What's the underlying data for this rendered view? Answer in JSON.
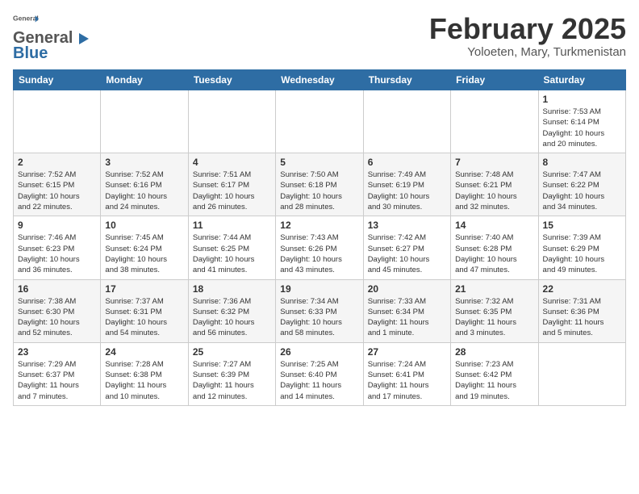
{
  "header": {
    "logo_line1": "General",
    "logo_line2": "Blue",
    "month": "February 2025",
    "location": "Yoloeten, Mary, Turkmenistan"
  },
  "weekdays": [
    "Sunday",
    "Monday",
    "Tuesday",
    "Wednesday",
    "Thursday",
    "Friday",
    "Saturday"
  ],
  "weeks": [
    [
      {
        "day": "",
        "info": ""
      },
      {
        "day": "",
        "info": ""
      },
      {
        "day": "",
        "info": ""
      },
      {
        "day": "",
        "info": ""
      },
      {
        "day": "",
        "info": ""
      },
      {
        "day": "",
        "info": ""
      },
      {
        "day": "1",
        "info": "Sunrise: 7:53 AM\nSunset: 6:14 PM\nDaylight: 10 hours\nand 20 minutes."
      }
    ],
    [
      {
        "day": "2",
        "info": "Sunrise: 7:52 AM\nSunset: 6:15 PM\nDaylight: 10 hours\nand 22 minutes."
      },
      {
        "day": "3",
        "info": "Sunrise: 7:52 AM\nSunset: 6:16 PM\nDaylight: 10 hours\nand 24 minutes."
      },
      {
        "day": "4",
        "info": "Sunrise: 7:51 AM\nSunset: 6:17 PM\nDaylight: 10 hours\nand 26 minutes."
      },
      {
        "day": "5",
        "info": "Sunrise: 7:50 AM\nSunset: 6:18 PM\nDaylight: 10 hours\nand 28 minutes."
      },
      {
        "day": "6",
        "info": "Sunrise: 7:49 AM\nSunset: 6:19 PM\nDaylight: 10 hours\nand 30 minutes."
      },
      {
        "day": "7",
        "info": "Sunrise: 7:48 AM\nSunset: 6:21 PM\nDaylight: 10 hours\nand 32 minutes."
      },
      {
        "day": "8",
        "info": "Sunrise: 7:47 AM\nSunset: 6:22 PM\nDaylight: 10 hours\nand 34 minutes."
      }
    ],
    [
      {
        "day": "9",
        "info": "Sunrise: 7:46 AM\nSunset: 6:23 PM\nDaylight: 10 hours\nand 36 minutes."
      },
      {
        "day": "10",
        "info": "Sunrise: 7:45 AM\nSunset: 6:24 PM\nDaylight: 10 hours\nand 38 minutes."
      },
      {
        "day": "11",
        "info": "Sunrise: 7:44 AM\nSunset: 6:25 PM\nDaylight: 10 hours\nand 41 minutes."
      },
      {
        "day": "12",
        "info": "Sunrise: 7:43 AM\nSunset: 6:26 PM\nDaylight: 10 hours\nand 43 minutes."
      },
      {
        "day": "13",
        "info": "Sunrise: 7:42 AM\nSunset: 6:27 PM\nDaylight: 10 hours\nand 45 minutes."
      },
      {
        "day": "14",
        "info": "Sunrise: 7:40 AM\nSunset: 6:28 PM\nDaylight: 10 hours\nand 47 minutes."
      },
      {
        "day": "15",
        "info": "Sunrise: 7:39 AM\nSunset: 6:29 PM\nDaylight: 10 hours\nand 49 minutes."
      }
    ],
    [
      {
        "day": "16",
        "info": "Sunrise: 7:38 AM\nSunset: 6:30 PM\nDaylight: 10 hours\nand 52 minutes."
      },
      {
        "day": "17",
        "info": "Sunrise: 7:37 AM\nSunset: 6:31 PM\nDaylight: 10 hours\nand 54 minutes."
      },
      {
        "day": "18",
        "info": "Sunrise: 7:36 AM\nSunset: 6:32 PM\nDaylight: 10 hours\nand 56 minutes."
      },
      {
        "day": "19",
        "info": "Sunrise: 7:34 AM\nSunset: 6:33 PM\nDaylight: 10 hours\nand 58 minutes."
      },
      {
        "day": "20",
        "info": "Sunrise: 7:33 AM\nSunset: 6:34 PM\nDaylight: 11 hours\nand 1 minute."
      },
      {
        "day": "21",
        "info": "Sunrise: 7:32 AM\nSunset: 6:35 PM\nDaylight: 11 hours\nand 3 minutes."
      },
      {
        "day": "22",
        "info": "Sunrise: 7:31 AM\nSunset: 6:36 PM\nDaylight: 11 hours\nand 5 minutes."
      }
    ],
    [
      {
        "day": "23",
        "info": "Sunrise: 7:29 AM\nSunset: 6:37 PM\nDaylight: 11 hours\nand 7 minutes."
      },
      {
        "day": "24",
        "info": "Sunrise: 7:28 AM\nSunset: 6:38 PM\nDaylight: 11 hours\nand 10 minutes."
      },
      {
        "day": "25",
        "info": "Sunrise: 7:27 AM\nSunset: 6:39 PM\nDaylight: 11 hours\nand 12 minutes."
      },
      {
        "day": "26",
        "info": "Sunrise: 7:25 AM\nSunset: 6:40 PM\nDaylight: 11 hours\nand 14 minutes."
      },
      {
        "day": "27",
        "info": "Sunrise: 7:24 AM\nSunset: 6:41 PM\nDaylight: 11 hours\nand 17 minutes."
      },
      {
        "day": "28",
        "info": "Sunrise: 7:23 AM\nSunset: 6:42 PM\nDaylight: 11 hours\nand 19 minutes."
      },
      {
        "day": "",
        "info": ""
      }
    ]
  ]
}
